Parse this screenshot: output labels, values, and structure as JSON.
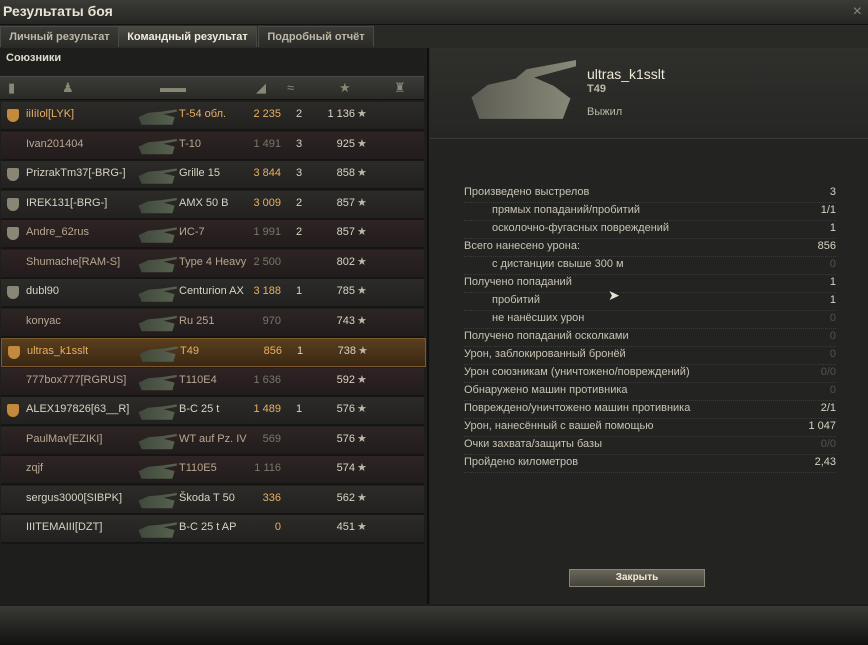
{
  "window": {
    "title": "Результаты боя",
    "close_icon": "×"
  },
  "tabs": [
    {
      "label": "Личный результат"
    },
    {
      "label": "Командный результат"
    },
    {
      "label": "Подробный отчёт"
    }
  ],
  "allies": {
    "title": "Союзники",
    "rows": [
      {
        "name": "iiIiIol[LYK]",
        "vehicle": "Т-54 обл.",
        "damage": "2 235",
        "kills": "2",
        "xp": "1 136",
        "state": "top",
        "badge": "gold"
      },
      {
        "name": "Ivan201404",
        "vehicle": "T-10",
        "damage": "1 491",
        "kills": "3",
        "xp": "925",
        "state": "dead",
        "badge": ""
      },
      {
        "name": "PrizrakTm37[-BRG-]",
        "vehicle": "Grille 15",
        "damage": "3 844",
        "kills": "3",
        "xp": "858",
        "state": "alive",
        "badge": "grey"
      },
      {
        "name": "IREK131[-BRG-]",
        "vehicle": "AMX 50 B",
        "damage": "3 009",
        "kills": "2",
        "xp": "857",
        "state": "alive",
        "badge": "grey"
      },
      {
        "name": "Andre_62rus",
        "vehicle": "ИС-7",
        "damage": "1 991",
        "kills": "2",
        "xp": "857",
        "state": "dead",
        "badge": "grey"
      },
      {
        "name": "Shumache[RAM-S]",
        "vehicle": "Type 4 Heavy",
        "damage": "2 500",
        "kills": "",
        "xp": "802",
        "state": "dead",
        "badge": ""
      },
      {
        "name": "dubl90",
        "vehicle": "Centurion AX",
        "damage": "3 188",
        "kills": "1",
        "xp": "785",
        "state": "alive",
        "badge": "grey"
      },
      {
        "name": "konyac",
        "vehicle": "Ru 251",
        "damage": "970",
        "kills": "",
        "xp": "743",
        "state": "dead",
        "badge": ""
      },
      {
        "name": "ultras_k1sslt",
        "vehicle": "T49",
        "damage": "856",
        "kills": "1",
        "xp": "738",
        "state": "me",
        "badge": "gold"
      },
      {
        "name": "777box777[RGRUS]",
        "vehicle": "T110E4",
        "damage": "1 636",
        "kills": "",
        "xp": "592",
        "state": "dead",
        "badge": ""
      },
      {
        "name": "ALEX197826[63__R]",
        "vehicle": "B-C 25 t",
        "damage": "1 489",
        "kills": "1",
        "xp": "576",
        "state": "alive",
        "badge": "gold"
      },
      {
        "name": "PaulMav[EZIKI]",
        "vehicle": "WT auf Pz. IV",
        "damage": "569",
        "kills": "",
        "xp": "576",
        "state": "dead",
        "badge": ""
      },
      {
        "name": "zqjf",
        "vehicle": "T110E5",
        "damage": "1 116",
        "kills": "",
        "xp": "574",
        "state": "dead",
        "badge": ""
      },
      {
        "name": "sergus3000[SIBPK]",
        "vehicle": "Škoda T 50",
        "damage": "336",
        "kills": "",
        "xp": "562",
        "state": "alive",
        "badge": ""
      },
      {
        "name": "IIITEMAIII[DZT]",
        "vehicle": "B-C 25 t AP",
        "damage": "0",
        "kills": "",
        "xp": "451",
        "state": "alive",
        "badge": ""
      }
    ]
  },
  "selected": {
    "player": "ultras_k1sslt",
    "vehicle": "T49",
    "status": "Выжил"
  },
  "stats": [
    {
      "label": "Произведено выстрелов",
      "value": "3",
      "sub": false,
      "zero": false
    },
    {
      "label": "прямых попаданий/пробитий",
      "value": "1/1",
      "sub": true,
      "zero": false
    },
    {
      "label": "осколочно-фугасных повреждений",
      "value": "1",
      "sub": true,
      "zero": false
    },
    {
      "label": "Всего нанесено урона:",
      "value": "856",
      "sub": false,
      "zero": false
    },
    {
      "label": "с дистанции свыше 300 м",
      "value": "0",
      "sub": true,
      "zero": true
    },
    {
      "label": "Получено попаданий",
      "value": "1",
      "sub": false,
      "zero": false
    },
    {
      "label": "пробитий",
      "value": "1",
      "sub": true,
      "zero": false
    },
    {
      "label": "не нанёсших урон",
      "value": "0",
      "sub": true,
      "zero": true
    },
    {
      "label": "Получено попаданий осколками",
      "value": "0",
      "sub": false,
      "zero": true
    },
    {
      "label": "Урон, заблокированный бронёй",
      "value": "0",
      "sub": false,
      "zero": true
    },
    {
      "label": "Урон союзникам (уничтожено/повреждений)",
      "value": "0/0",
      "sub": false,
      "zero": true
    },
    {
      "label": "Обнаружено машин противника",
      "value": "0",
      "sub": false,
      "zero": true
    },
    {
      "label": "Повреждено/уничтожено машин противника",
      "value": "2/1",
      "sub": false,
      "zero": false
    },
    {
      "label": "Урон, нанесённый с вашей помощью",
      "value": "1 047",
      "sub": false,
      "zero": false
    },
    {
      "label": "Очки захвата/защиты базы",
      "value": "0/0",
      "sub": false,
      "zero": true
    },
    {
      "label": "Пройдено километров",
      "value": "2,43",
      "sub": false,
      "zero": false
    }
  ],
  "close_button": "Закрыть",
  "icons": {
    "star": "★"
  },
  "colors": {
    "highlight_row": "#5a3e1e",
    "gold_text": "#e8b060",
    "dim_text": "#7a766a"
  }
}
